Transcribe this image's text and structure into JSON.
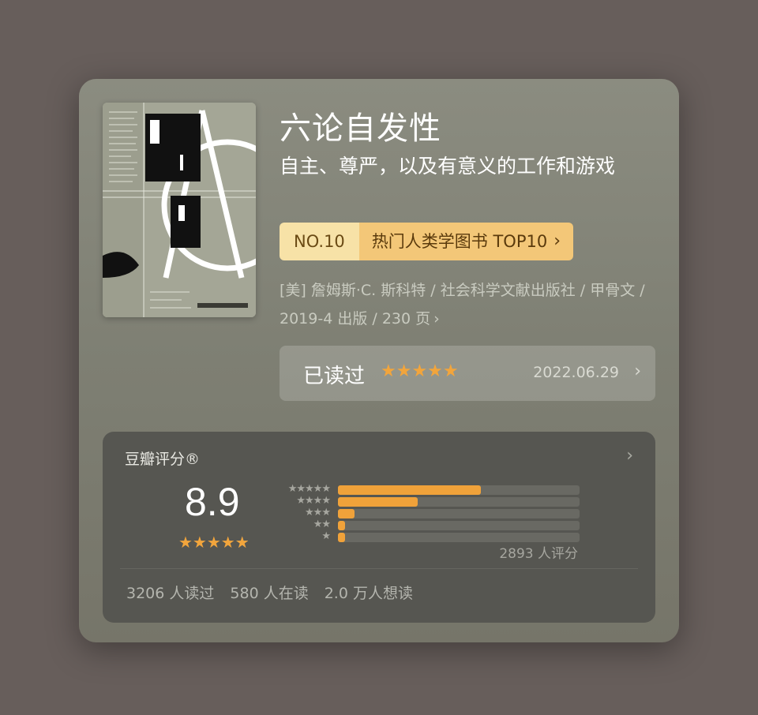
{
  "book": {
    "title": "六论自发性",
    "subtitle": "自主、尊严，以及有意义的工作和游戏",
    "rank": {
      "no": "NO.10",
      "list": "热门人类学图书 TOP10"
    },
    "meta": "[美] 詹姆斯·C. 斯科特 / 社会科学文献出版社 / 甲骨文 / 2019-4 出版 / 230 页"
  },
  "read_status": {
    "label": "已读过",
    "stars": "★★★★★",
    "date": "2022.06.29"
  },
  "rating": {
    "title": "豆瓣评分®",
    "score": "8.9",
    "score_stars_full": "★★★★",
    "score_half_star": "★",
    "score_fraction": 0.9,
    "distribution": [
      {
        "stars": "★★★★★",
        "fraction": 0.59
      },
      {
        "stars": "★★★★",
        "fraction": 0.33
      },
      {
        "stars": "★★★",
        "fraction": 0.07
      },
      {
        "stars": "★★",
        "fraction": 0.03
      },
      {
        "stars": "★",
        "fraction": 0.03
      }
    ],
    "count": "2893 人评分",
    "read": "3206 人读过",
    "reading": "580 人在读",
    "want": "2.0 万人想读"
  },
  "icons": {
    "chevron": "chevron-right-icon"
  },
  "colors": {
    "accent_star": "#f2a53c",
    "rank_no_bg": "#f7e2a7",
    "rank_list_bg": "#f3c778",
    "card_bg": "#85867a",
    "panel_bg": "#565651"
  }
}
